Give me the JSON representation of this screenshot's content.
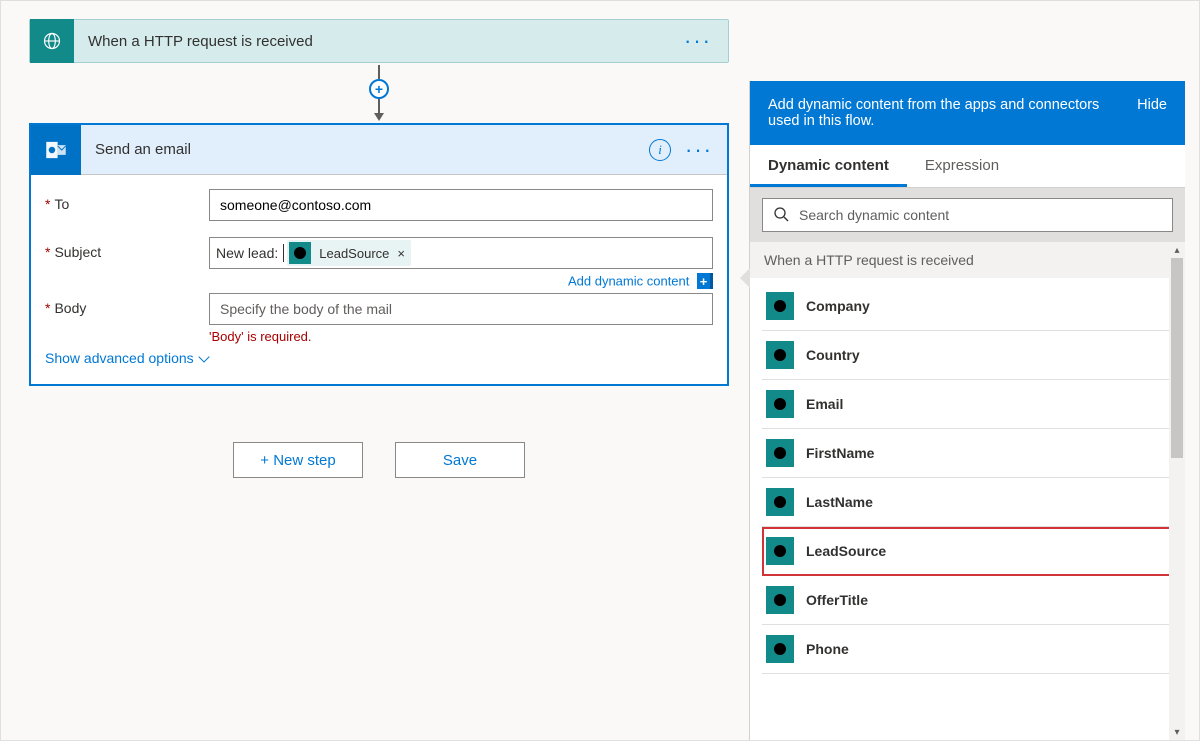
{
  "trigger": {
    "title": "When a HTTP request is received"
  },
  "email_card": {
    "title": "Send an email",
    "fields": {
      "to_label": "To",
      "to_value": "someone@contoso.com",
      "subject_label": "Subject",
      "subject_prefix": "New lead:",
      "subject_token": "LeadSource",
      "body_label": "Body",
      "body_placeholder": "Specify the body of the mail",
      "body_error": "'Body' is required."
    },
    "add_dynamic_link": "Add dynamic content",
    "show_advanced": "Show advanced options"
  },
  "bottom": {
    "new_step": "+ New step",
    "save": "Save"
  },
  "panel": {
    "header_text": "Add dynamic content from the apps and connectors used in this flow.",
    "hide": "Hide",
    "tab_dynamic": "Dynamic content",
    "tab_expression": "Expression",
    "search_placeholder": "Search dynamic content",
    "group_title": "When a HTTP request is received",
    "items": [
      {
        "name": "Company",
        "highlighted": false
      },
      {
        "name": "Country",
        "highlighted": false
      },
      {
        "name": "Email",
        "highlighted": false
      },
      {
        "name": "FirstName",
        "highlighted": false
      },
      {
        "name": "LastName",
        "highlighted": false
      },
      {
        "name": "LeadSource",
        "highlighted": true
      },
      {
        "name": "OfferTitle",
        "highlighted": false
      },
      {
        "name": "Phone",
        "highlighted": false
      }
    ]
  }
}
